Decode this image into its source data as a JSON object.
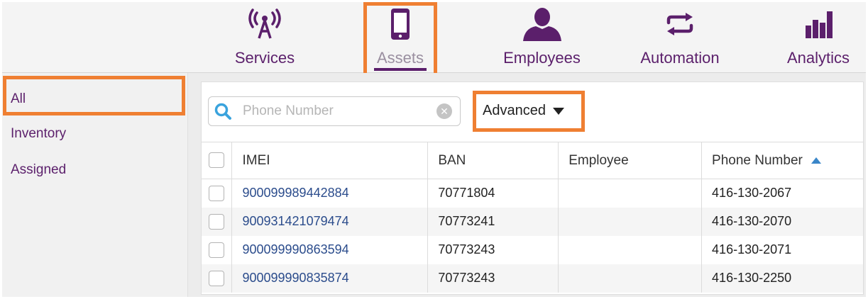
{
  "nav": {
    "items": [
      {
        "label": "Services",
        "icon": "antenna-icon"
      },
      {
        "label": "Assets",
        "icon": "phone-icon"
      },
      {
        "label": "Employees",
        "icon": "person-icon"
      },
      {
        "label": "Automation",
        "icon": "swap-arrows-icon"
      },
      {
        "label": "Analytics",
        "icon": "bar-chart-icon"
      }
    ],
    "active": "Assets"
  },
  "sidebar": {
    "items": [
      {
        "label": "All"
      },
      {
        "label": "Inventory"
      },
      {
        "label": "Assigned"
      }
    ],
    "selected": "All"
  },
  "search": {
    "placeholder": "Phone Number",
    "value": ""
  },
  "advanced": {
    "label": "Advanced"
  },
  "table": {
    "columns": [
      "IMEI",
      "BAN",
      "Employee",
      "Phone Number"
    ],
    "sort_column": "Phone Number",
    "sort_direction": "ascending",
    "rows": [
      {
        "imei": "900099989442884",
        "ban": "70771804",
        "employee": "",
        "phone": "416-130-2067"
      },
      {
        "imei": "900931421079474",
        "ban": "70773241",
        "employee": "",
        "phone": "416-130-2070"
      },
      {
        "imei": "900099990863594",
        "ban": "70773243",
        "employee": "",
        "phone": "416-130-2071"
      },
      {
        "imei": "900099990835874",
        "ban": "70773243",
        "employee": "",
        "phone": "416-130-2250"
      }
    ]
  },
  "colors": {
    "brand_purple": "#5b1f6b",
    "highlight_orange": "#ef7f32",
    "link_blue": "#2b4c8c",
    "search_icon_blue": "#3aa3dd"
  }
}
